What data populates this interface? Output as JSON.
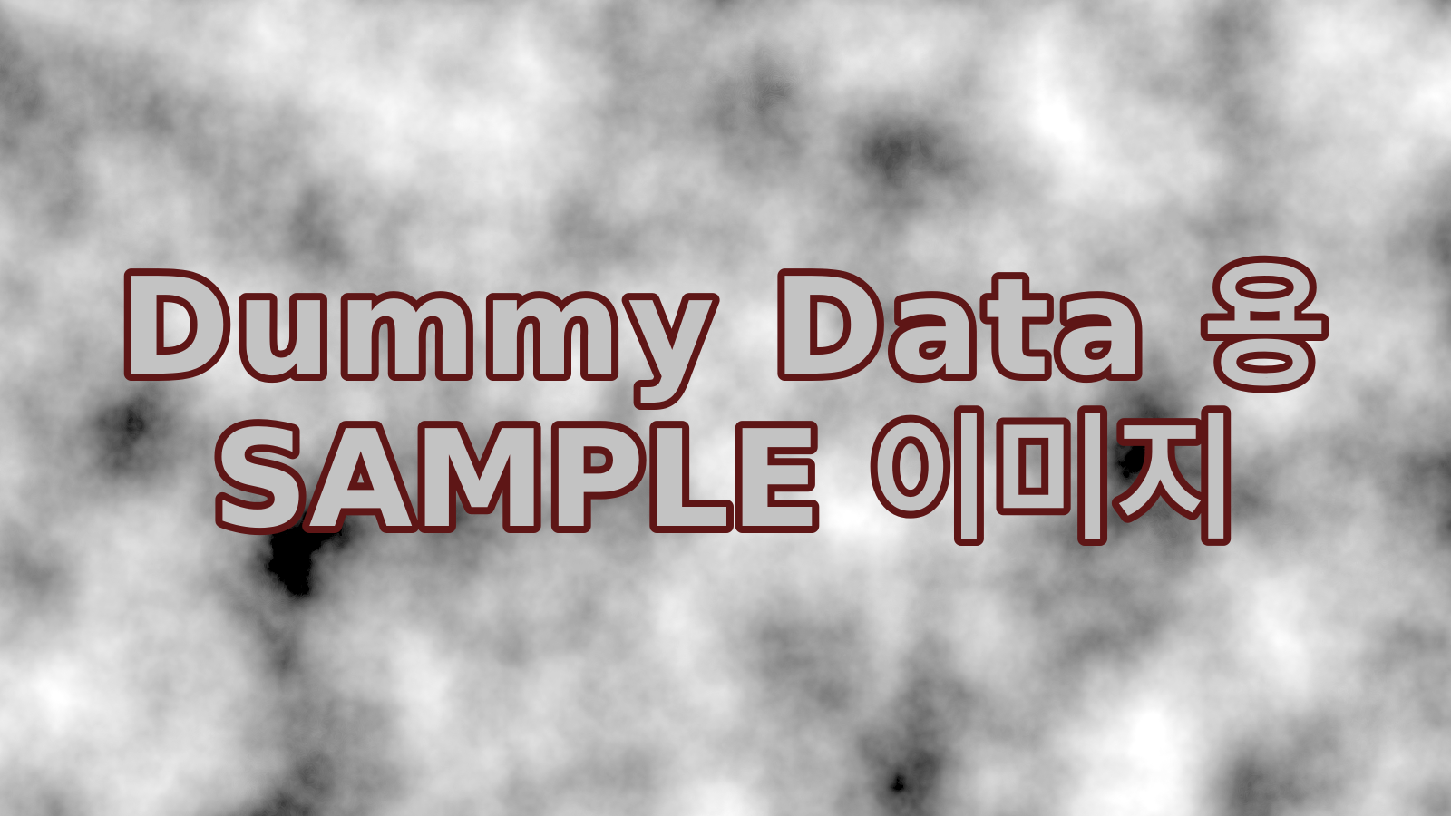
{
  "title": {
    "line1": "Dummy Data 용",
    "line2": "SAMPLE 이미지"
  },
  "colors": {
    "text_fill": "#c3c3c3",
    "text_stroke": "#5e1616",
    "cloud_dark": "#1e1e1e",
    "cloud_light": "#f2f2f2"
  }
}
